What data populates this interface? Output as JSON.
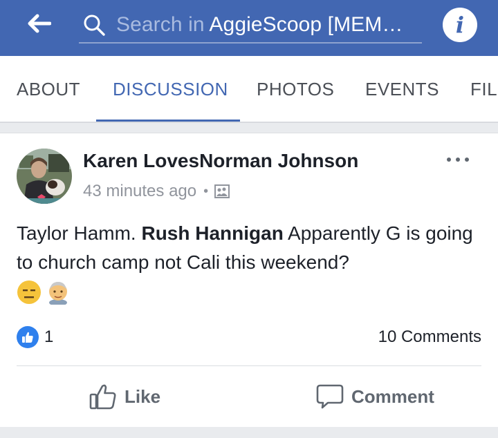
{
  "topbar": {
    "search_prefix": "Search in ",
    "search_query": "AggieScoop [MEM…",
    "icons": {
      "back": "arrow-left-icon",
      "search": "search-icon",
      "info": "info-icon"
    },
    "info_glyph": "i"
  },
  "tabs": [
    {
      "label": "ABOUT",
      "active": false
    },
    {
      "label": "DISCUSSION",
      "active": true
    },
    {
      "label": "PHOTOS",
      "active": false
    },
    {
      "label": "EVENTS",
      "active": false
    },
    {
      "label": "FIL",
      "active": false
    }
  ],
  "post": {
    "author": "Karen LovesNorman Johnson",
    "time": "43 minutes ago",
    "separator": "•",
    "privacy_icon": "group-photo-icon",
    "text_before": "Taylor Hamm. ",
    "mention": "Rush Hannigan",
    "text_after": " Apparently G is going to church camp not Cali this weekend?",
    "emojis": [
      "expressionless-face-emoji",
      "older-man-emoji"
    ],
    "reactions": {
      "like_count": "1",
      "comments": "10 Comments"
    },
    "actions": {
      "like": "Like",
      "comment": "Comment"
    }
  },
  "colors": {
    "brand": "#4267b2",
    "like_badge": "#2f80ed",
    "muted": "#90949c"
  }
}
